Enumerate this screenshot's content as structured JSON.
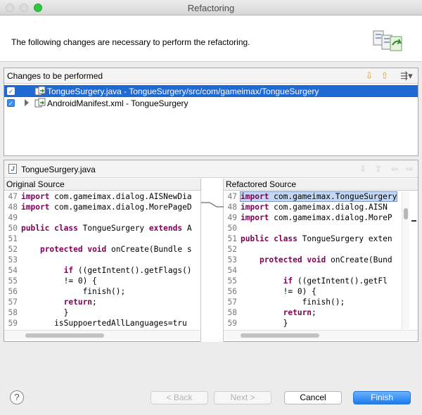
{
  "window": {
    "title": "Refactoring"
  },
  "header": {
    "message": "The following changes are necessary to perform the refactoring."
  },
  "changes": {
    "title": "Changes to be performed",
    "items": [
      {
        "label": "TongueSurgery.java - TongueSurgery/src/com/gameimax/TongueSurgery",
        "checked": true,
        "selected": true
      },
      {
        "label": "AndroidManifest.xml - TongueSurgery",
        "checked": true,
        "selected": false
      }
    ]
  },
  "compare": {
    "file": "TongueSurgery.java",
    "original_title": "Original Source",
    "refactored_title": "Refactored Source",
    "original_lines": [
      {
        "n": "47",
        "t": "import com.gameimax.dialog.AISNewDia"
      },
      {
        "n": "48",
        "t": "import com.gameimax.dialog.MorePageD"
      },
      {
        "n": "49",
        "t": ""
      },
      {
        "n": "50",
        "t": "public class TongueSurgery extends A"
      },
      {
        "n": "51",
        "t": ""
      },
      {
        "n": "52",
        "t": "    protected void onCreate(Bundle s"
      },
      {
        "n": "53",
        "t": ""
      },
      {
        "n": "54",
        "t": "         if ((getIntent().getFlags()"
      },
      {
        "n": "55",
        "t": "         != 0) {"
      },
      {
        "n": "56",
        "t": "             finish();"
      },
      {
        "n": "57",
        "t": "         return;"
      },
      {
        "n": "58",
        "t": "         }"
      },
      {
        "n": "59",
        "t": "       isSuppoertedAllLanguages=tru"
      }
    ],
    "refactored_lines": [
      {
        "n": "47",
        "t": "import com.gameimax.TongueSurgery"
      },
      {
        "n": "48",
        "t": "import com.gameimax.dialog.AISN"
      },
      {
        "n": "49",
        "t": "import com.gameimax.dialog.MoreP"
      },
      {
        "n": "50",
        "t": ""
      },
      {
        "n": "51",
        "t": "public class TongueSurgery exten"
      },
      {
        "n": "52",
        "t": ""
      },
      {
        "n": "53",
        "t": "    protected void onCreate(Bund"
      },
      {
        "n": "54",
        "t": ""
      },
      {
        "n": "55",
        "t": "         if ((getIntent().getFl"
      },
      {
        "n": "56",
        "t": "         != 0) {"
      },
      {
        "n": "57",
        "t": "             finish();"
      },
      {
        "n": "58",
        "t": "         return;"
      },
      {
        "n": "59",
        "t": "         }"
      }
    ]
  },
  "buttons": {
    "help": "?",
    "back": "< Back",
    "next": "Next >",
    "cancel": "Cancel",
    "finish": "Finish"
  },
  "colors": {
    "selection": "#1f69d3",
    "keyword": "#7f0055",
    "primary_button": "#197cf2"
  }
}
